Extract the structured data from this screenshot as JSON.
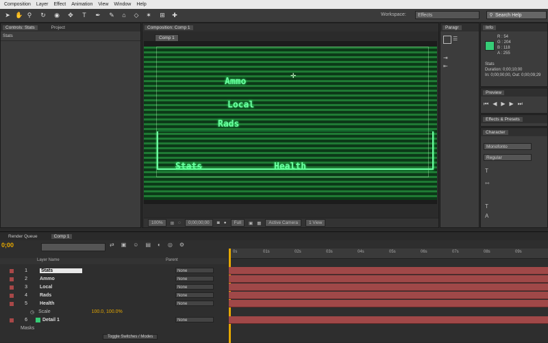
{
  "menu": [
    "Composition",
    "Layer",
    "Effect",
    "Animation",
    "View",
    "Window",
    "Help"
  ],
  "workspace": {
    "label": "Workspace:",
    "value": "Effects"
  },
  "search": {
    "placeholder": "Search Help"
  },
  "left_panel": {
    "tabs": [
      "Controls: Stats",
      "Project"
    ],
    "sub_label": "Stats"
  },
  "composition": {
    "tab": "Composition: Comp 1",
    "chip": "Comp 1",
    "texts": {
      "ammo": "Ammo",
      "local": "Local",
      "rads": "Rads",
      "stats": "Stats",
      "health": "Health"
    }
  },
  "viewer_bar": {
    "zoom": "100%",
    "timecode": "0;00;00;00",
    "quality": "Full",
    "camera": "Active Camera",
    "views": "1 View"
  },
  "right": {
    "tools_tab": "Paragr",
    "info_tab": "Info",
    "info": {
      "r": "R : 54",
      "g": "G : 204",
      "b": "B : 118",
      "a": "A : 255",
      "name": "Stats",
      "duration": "Duration: 0;00;10;00",
      "inout": "In: 0;00;00;00, Out: 0;00;09;29"
    },
    "preview_tab": "Preview",
    "effects_tab": "Effects & Presets",
    "character_tab": "Character",
    "font": "Monofonto",
    "style": "Regular"
  },
  "timeline": {
    "tabs": [
      "Render Queue",
      "Comp 1"
    ],
    "timecode": "0;00",
    "columns": {
      "source": "Layer Name",
      "parent": "Parent"
    },
    "ruler": [
      "0s",
      "01s",
      "02s",
      "03s",
      "04s",
      "05s",
      "06s",
      "07s",
      "08s",
      "09s"
    ],
    "layers": [
      {
        "num": "1",
        "name": "Stats",
        "parent": "None",
        "selected": true
      },
      {
        "num": "2",
        "name": "Ammo",
        "parent": "None"
      },
      {
        "num": "3",
        "name": "Local",
        "parent": "None"
      },
      {
        "num": "4",
        "name": "Rads",
        "parent": "None"
      },
      {
        "num": "5",
        "name": "Health",
        "parent": "None"
      },
      {
        "num": "6",
        "name": "Detail 1",
        "parent": "None"
      }
    ],
    "scale_label": "Scale",
    "scale_value": "100.0, 100.0%",
    "masks_label": "Masks",
    "footer": "Toggle Switches / Modes"
  }
}
